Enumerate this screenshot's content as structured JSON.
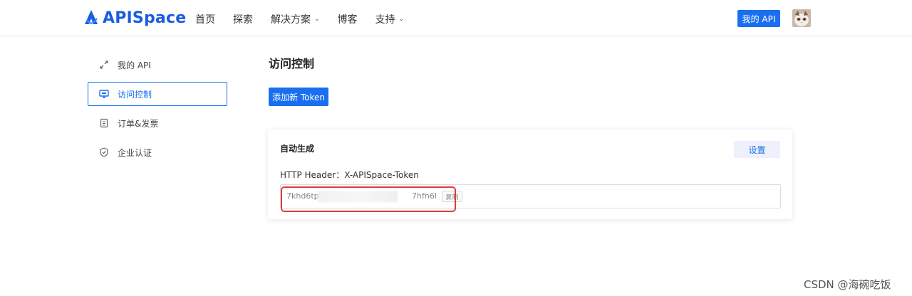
{
  "header": {
    "logo_text": "APISpace",
    "nav": [
      {
        "label": "首页",
        "dropdown": false
      },
      {
        "label": "探索",
        "dropdown": false
      },
      {
        "label": "解决方案",
        "dropdown": true
      },
      {
        "label": "博客",
        "dropdown": false
      },
      {
        "label": "支持",
        "dropdown": true
      }
    ],
    "my_api_label": "我的 API"
  },
  "sidebar": {
    "items": [
      {
        "label": "我的 API",
        "icon": "arrows-icon",
        "active": false
      },
      {
        "label": "访问控制",
        "icon": "monitor-icon",
        "active": true
      },
      {
        "label": "订单&发票",
        "icon": "clipboard-icon",
        "active": false
      },
      {
        "label": "企业认证",
        "icon": "shield-icon",
        "active": false
      }
    ]
  },
  "main": {
    "title": "访问控制",
    "add_token_label": "添加新 Token",
    "card": {
      "title": "自动生成",
      "settings_label": "设置",
      "header_line": "HTTP Header：X-APISpace-Token",
      "token_prefix": "7khd6tp",
      "token_suffix": "7hfn6l",
      "copy_label": "复制"
    }
  },
  "watermark": "CSDN @海碗吃饭",
  "colors": {
    "accent": "#1a6ff0",
    "brand": "#1a5be0",
    "highlight": "#e23b3b"
  }
}
